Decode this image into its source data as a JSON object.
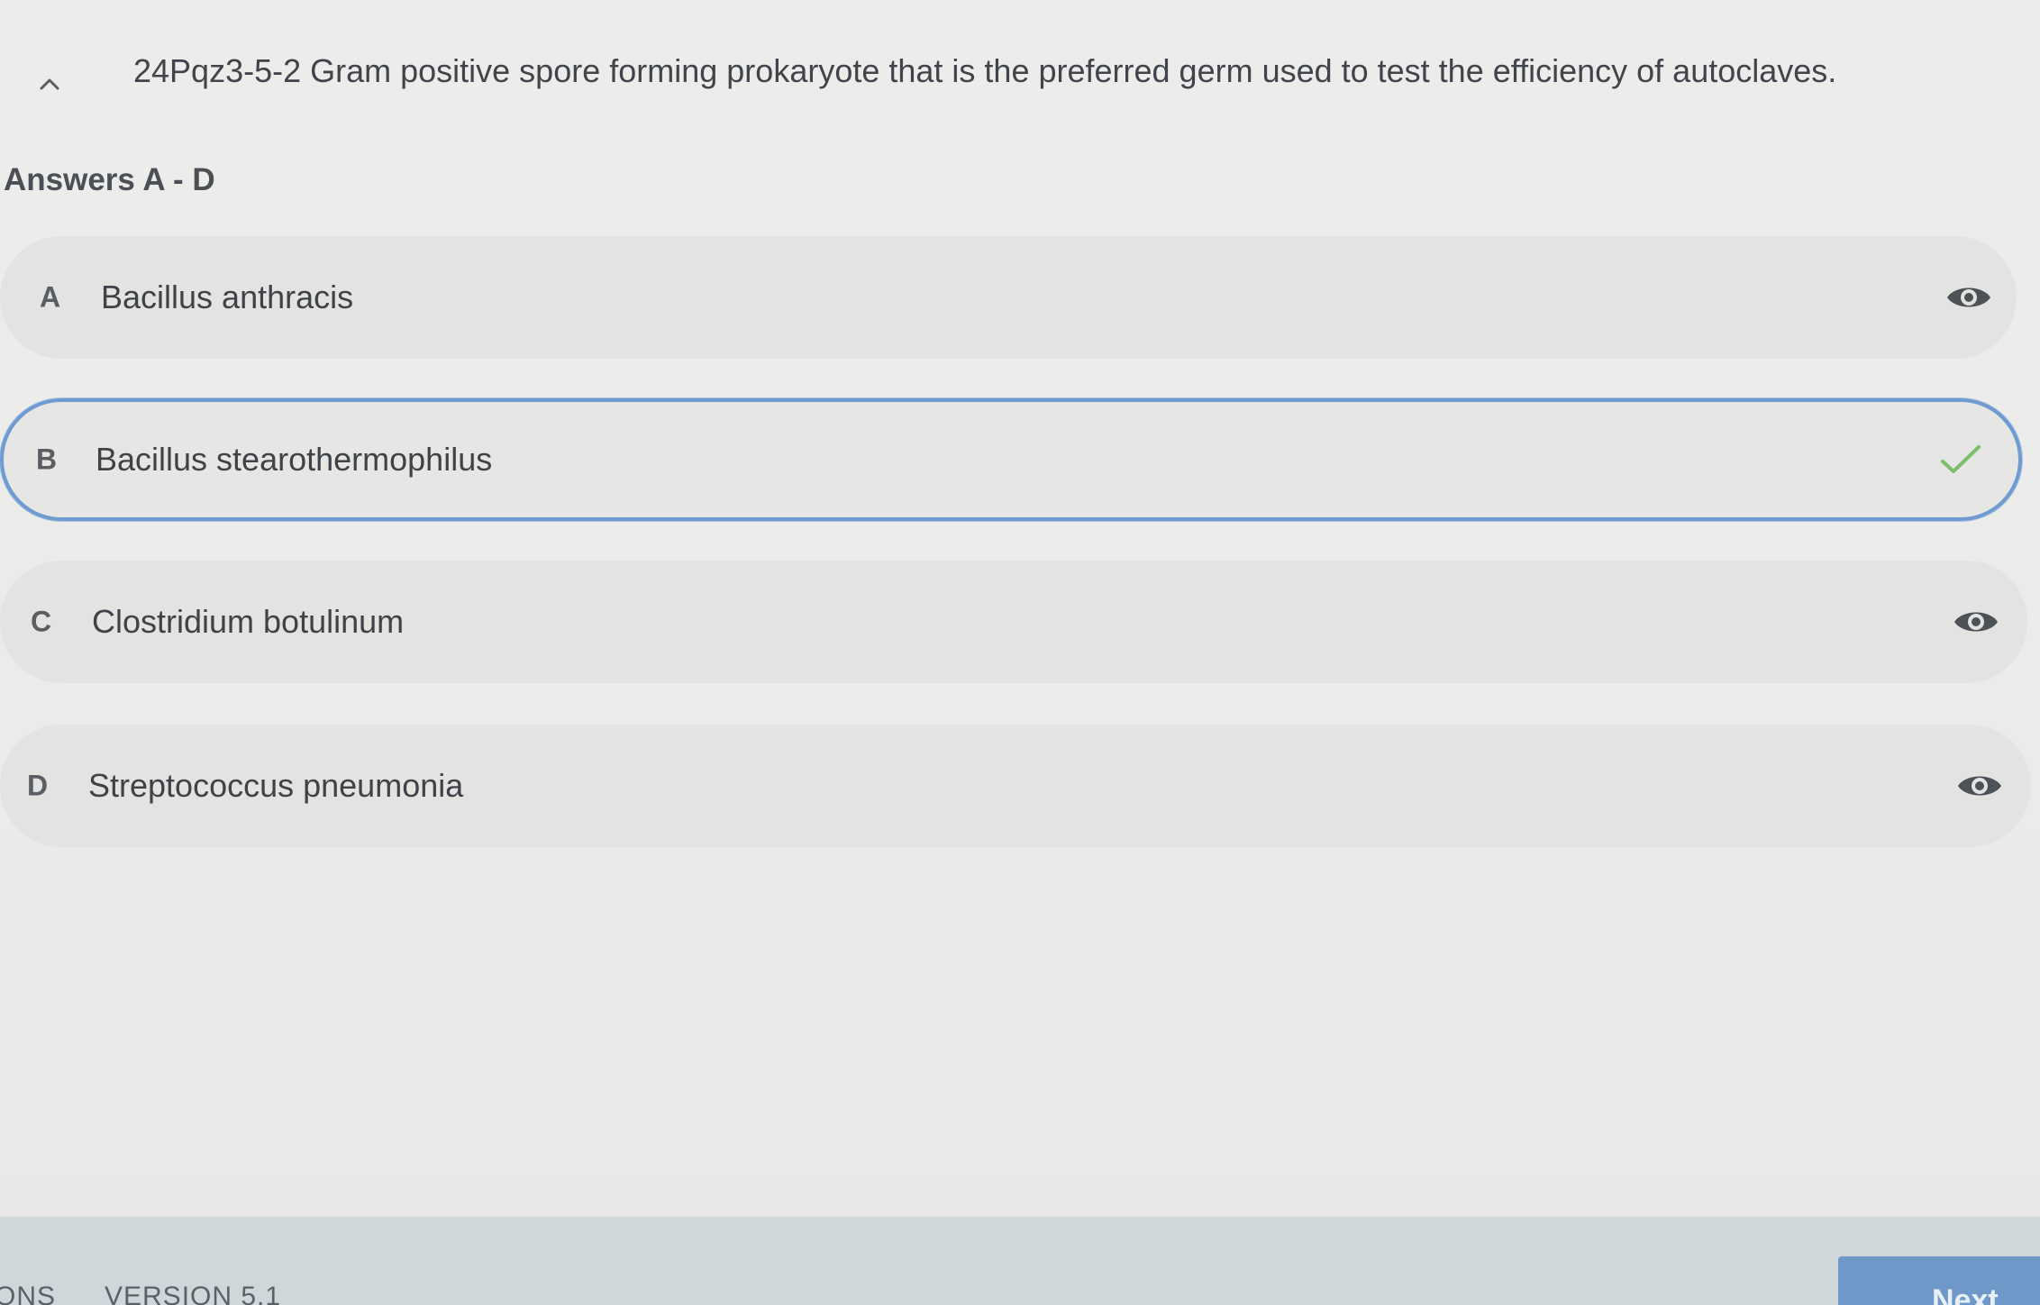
{
  "question": {
    "text": "24Pqz3-5-2 Gram positive spore forming prokaryote that is the preferred germ used to test the efficiency of autoclaves.",
    "collapse_icon": "chevron-up-icon"
  },
  "answers": {
    "heading": "Answers A - D",
    "options": [
      {
        "letter": "A",
        "text": "Bacillus anthracis",
        "icon": "eye-icon",
        "selected": false
      },
      {
        "letter": "B",
        "text": "Bacillus stearothermophilus",
        "icon": "checkmark-icon",
        "selected": true
      },
      {
        "letter": "C",
        "text": "Clostridium botulinum",
        "icon": "eye-icon",
        "selected": false
      },
      {
        "letter": "D",
        "text": "Streptococcus pneumonia",
        "icon": "eye-icon",
        "selected": false
      }
    ]
  },
  "footer": {
    "link_text": "ONS",
    "version": "VERSION 5.1",
    "next_label": "Next"
  },
  "colors": {
    "selected_border": "#6f9bd0",
    "check": "#7cbf6a",
    "next_button": "#6e98c7"
  }
}
